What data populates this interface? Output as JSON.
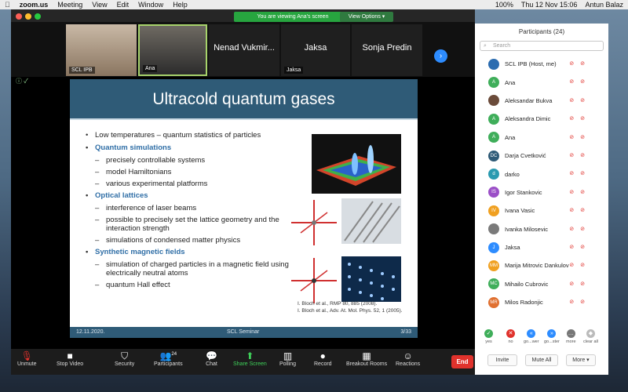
{
  "menubar": {
    "app": "zoom.us",
    "items": [
      "Meeting",
      "View",
      "Edit",
      "Window",
      "Help"
    ],
    "battery": "100%",
    "datetime": "Thu 12 Nov  15:06",
    "user": "Antun Balaz"
  },
  "banner": {
    "viewing": "You are viewing Ana's screen",
    "options": "View Options"
  },
  "thumbnails": [
    {
      "name": "SCL IPB"
    },
    {
      "name": "Ana"
    },
    {
      "name": "Nenad Vukmir..."
    },
    {
      "name": "Jaksa",
      "label": "Jaksa"
    },
    {
      "name": "Sonja Predin"
    }
  ],
  "slide": {
    "title": "Ultracold quantum gases",
    "bullets": [
      {
        "text": "Low temperatures – quantum statistics of particles",
        "heading": false,
        "subs": []
      },
      {
        "text": "Quantum simulations",
        "heading": true,
        "subs": [
          "precisely controllable systems",
          "model Hamiltonians",
          "various experimental platforms"
        ]
      },
      {
        "text": "Optical lattices",
        "heading": true,
        "subs": [
          "interference of laser beams",
          "possible to precisely set the lattice geometry and the interaction strength",
          "simulations of condensed matter physics"
        ]
      },
      {
        "text": "Synthetic magnetic fields",
        "heading": true,
        "subs": [
          "simulation of charged particles in a magnetic field using electrically neutral atoms",
          "quantum Hall effect"
        ]
      }
    ],
    "refs": [
      "I. Bloch et al., RMP 80, 885 (2008).",
      "I. Bloch et al., Adv. At. Mol. Phys. 52, 1 (2005)."
    ],
    "footer": {
      "date": "12.11.2020.",
      "event": "SCL Seminar",
      "page": "3/33"
    }
  },
  "controls": {
    "unmute": "Unmute",
    "stop_video": "Stop Video",
    "security": "Security",
    "participants": "Participants",
    "participants_count": "24",
    "chat": "Chat",
    "share_screen": "Share Screen",
    "polling": "Polling",
    "record": "Record",
    "breakout": "Breakout Rooms",
    "reactions": "Reactions",
    "end": "End"
  },
  "panel": {
    "title": "Participants (24)",
    "search_placeholder": "Search",
    "participants": [
      {
        "name": "SCL IPB (Host, me)",
        "initials": "",
        "color": "#2b6cb0"
      },
      {
        "name": "Ana",
        "initials": "A",
        "color": "#3fae5a"
      },
      {
        "name": "Aleksandar Bukva",
        "initials": "",
        "color": "#6b4b3a"
      },
      {
        "name": "Aleksandra Dimic",
        "initials": "A",
        "color": "#3fae5a"
      },
      {
        "name": "Ana",
        "initials": "A",
        "color": "#3fae5a"
      },
      {
        "name": "Darja Cvetković",
        "initials": "DC",
        "color": "#2f5b77"
      },
      {
        "name": "darko",
        "initials": "d",
        "color": "#2a9ab0"
      },
      {
        "name": "Igor Stankovic",
        "initials": "IS",
        "color": "#9b4fc7"
      },
      {
        "name": "Ivana Vasic",
        "initials": "IV",
        "color": "#f0a020"
      },
      {
        "name": "Ivanka Milosevic",
        "initials": "",
        "color": "#7a7a7a"
      },
      {
        "name": "Jaksa",
        "initials": "J",
        "color": "#2d8cff"
      },
      {
        "name": "Marija Mitrovic Dankulov",
        "initials": "MM",
        "color": "#f0a020"
      },
      {
        "name": "Mihailo Cubrovic",
        "initials": "MC",
        "color": "#3fae5a"
      },
      {
        "name": "Milos Radonjic",
        "initials": "MR",
        "color": "#e07030"
      }
    ],
    "actions": [
      "yes",
      "no",
      "go...wer",
      "go...ster",
      "more",
      "clear all"
    ],
    "buttons": {
      "invite": "Invite",
      "mute_all": "Mute All",
      "more": "More"
    }
  }
}
